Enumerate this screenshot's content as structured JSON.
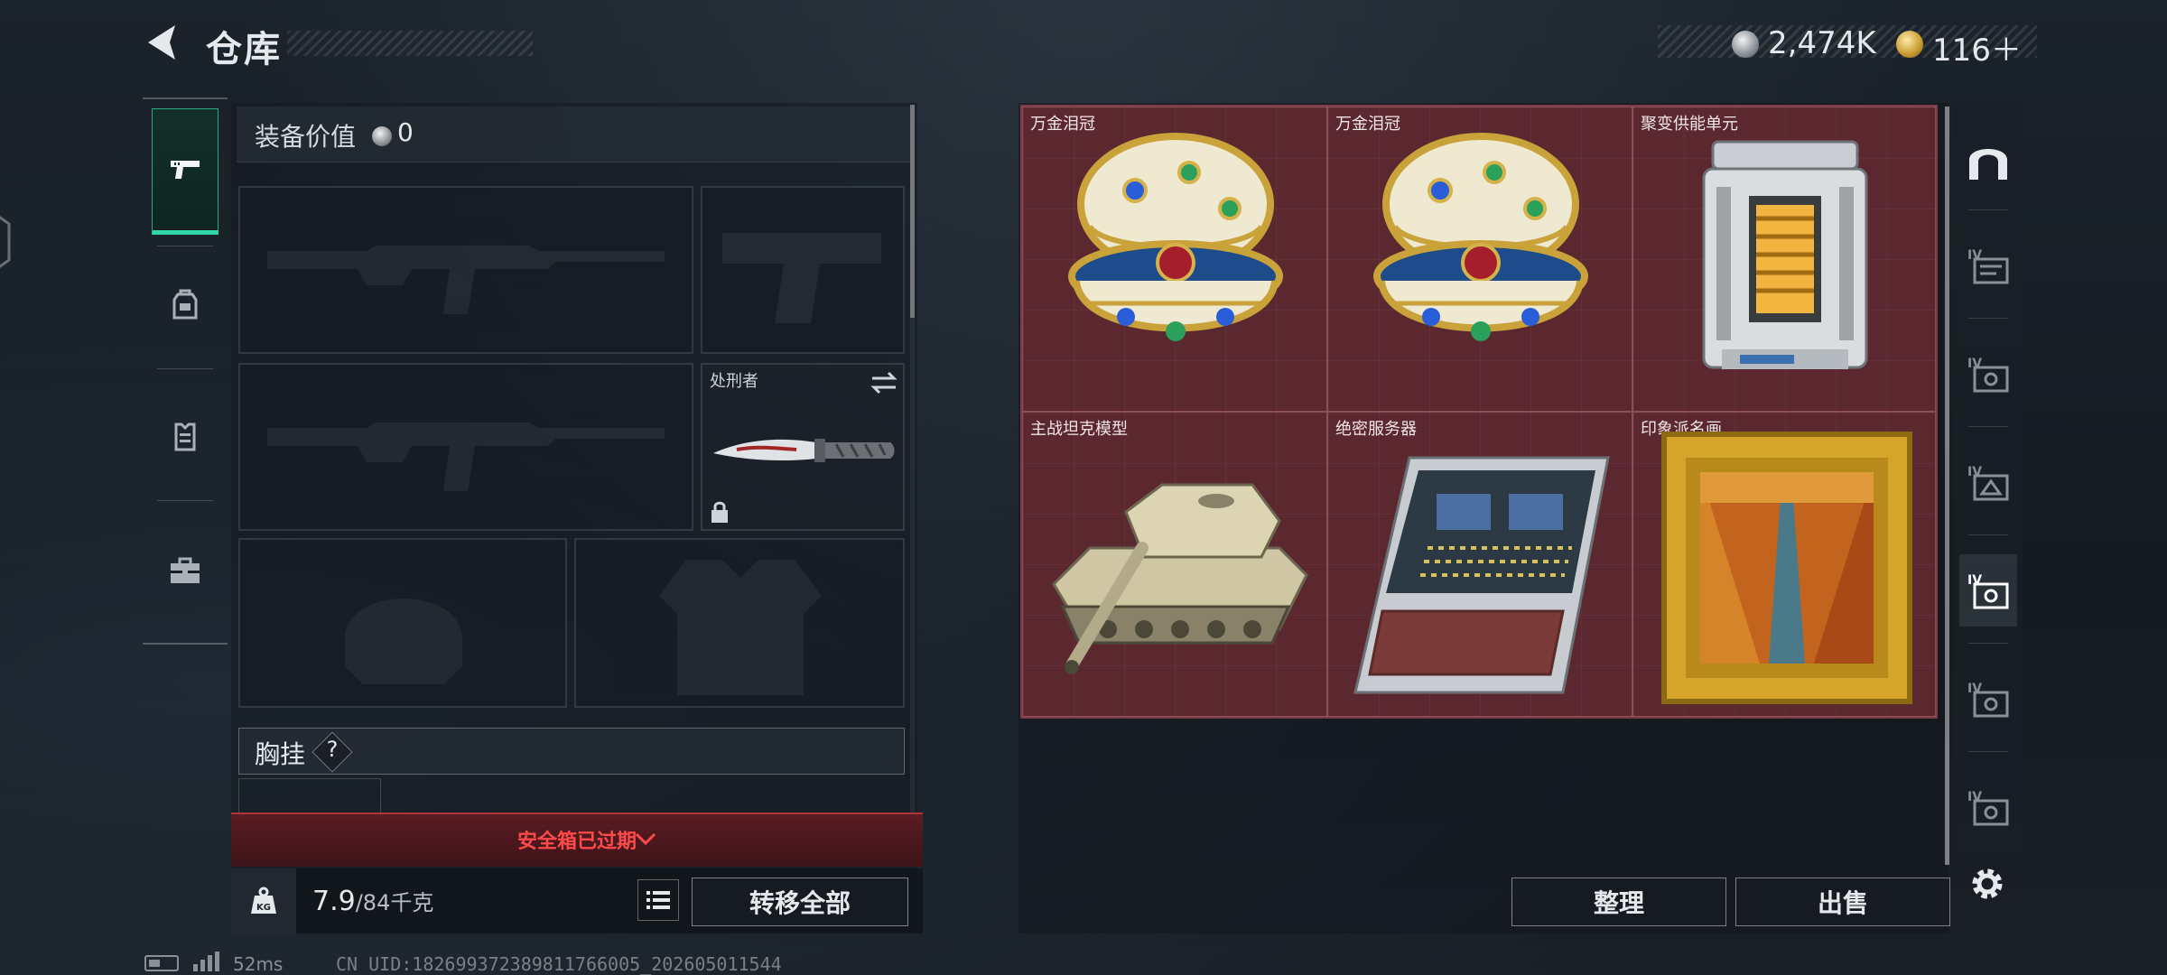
{
  "header": {
    "title": "仓库",
    "currency_silver": "2,474K",
    "currency_gold": "116＋"
  },
  "left_tabs": [
    {
      "name": "weapons",
      "icon": "pistol-icon",
      "active": true
    },
    {
      "name": "gear",
      "icon": "backpack-icon",
      "active": false
    },
    {
      "name": "vest",
      "icon": "vest-icon",
      "active": false
    },
    {
      "name": "case",
      "icon": "toolbox-icon",
      "active": false
    }
  ],
  "equipment": {
    "value_label": "装备价值",
    "value_amount": "0",
    "melee_slot_label": "处刑者",
    "chest_rig_label": "胸挂",
    "chest_rig_help": "?"
  },
  "safe_box": {
    "status_text": "安全箱已过期"
  },
  "bottom_left": {
    "weight_current": "7.9",
    "weight_max": "/84千克",
    "transfer_all_label": "转移全部"
  },
  "storage": {
    "items": [
      {
        "label": "万金泪冠",
        "icon": "jeweled-egg-icon"
      },
      {
        "label": "万金泪冠",
        "icon": "jeweled-egg-icon"
      },
      {
        "label": "聚变供能单元",
        "icon": "fusion-cell-icon"
      },
      {
        "label": "主战坦克模型",
        "icon": "tank-model-icon"
      },
      {
        "label": "绝密服务器",
        "icon": "server-icon"
      },
      {
        "label": "印象派名画",
        "icon": "framed-painting-icon"
      }
    ],
    "sort_label": "整理",
    "sell_label": "出售"
  },
  "right_tabs": [
    {
      "name": "home",
      "icon": "arch-icon"
    },
    {
      "name": "storage-1",
      "icon": "storage-tab-icon"
    },
    {
      "name": "storage-2",
      "icon": "storage-tab-icon"
    },
    {
      "name": "storage-3",
      "icon": "storage-tab-icon"
    },
    {
      "name": "storage-4",
      "icon": "storage-tab-icon",
      "active": true
    },
    {
      "name": "storage-5",
      "icon": "storage-tab-icon"
    },
    {
      "name": "storage-6",
      "icon": "storage-tab-icon"
    }
  ],
  "status_bar": {
    "ping": "52ms",
    "uid": "CN UID:182699372389811766005_202605011544"
  },
  "colors": {
    "accent_green": "#33d6a6",
    "grid_bg": "#5c2830",
    "warning_red": "#ff4a4a"
  }
}
